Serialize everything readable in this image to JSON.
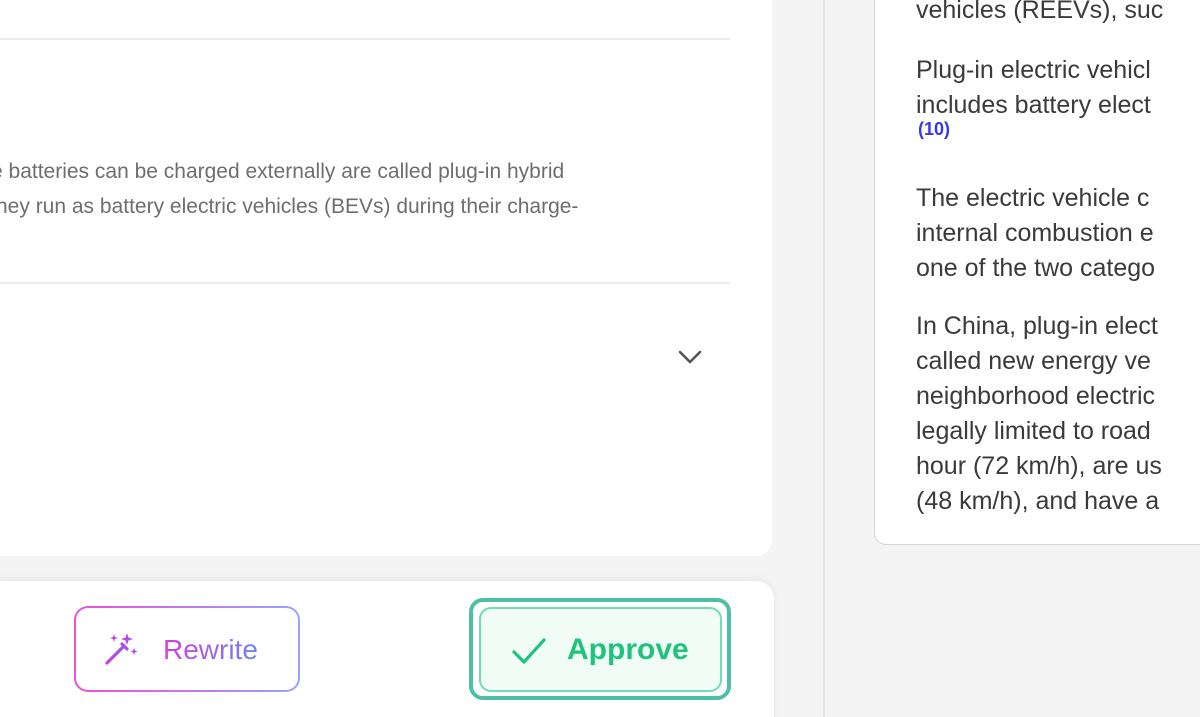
{
  "editor": {
    "excerpt_lines": [
      "e batteries can be charged externally are called plug-in hybrid",
      "hey run as battery electric vehicles (BEVs) during their charge-"
    ],
    "expand_icon": "chevron-down-icon"
  },
  "actions": {
    "rewrite_label": "Rewrite",
    "rewrite_icon": "magic-wand-icon",
    "approve_label": "Approve",
    "approve_icon": "check-icon",
    "approve_color": "#1fc37b",
    "focus_ring_color": "#4dbfa6"
  },
  "source": {
    "para0_line1": "vehicles (REEVs), suc",
    "para1_line1": "Plug-in electric vehicl",
    "para1_line2": "includes battery elect",
    "citation": "(10)",
    "para2_line1": "The electric vehicle c",
    "para2_line2": "internal combustion e",
    "para2_line3": "one of the two catego",
    "para3_line1": "In China, plug-in elect",
    "para3_line2": "called new energy ve",
    "para3_line3": "neighborhood electric",
    "para3_line4": "legally limited to road",
    "para3_line5": "hour (72 km/h), are us",
    "para3_line6": "(48 km/h), and have a"
  }
}
